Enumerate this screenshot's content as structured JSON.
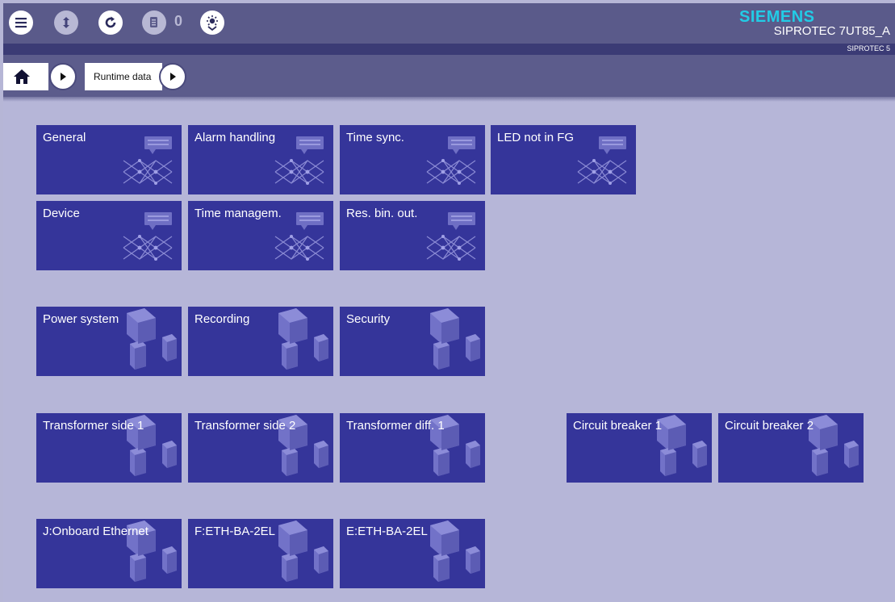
{
  "header": {
    "brand": "SIEMENS",
    "device_name": "SIPROTEC 7UT85_A",
    "device_model": "SIPROTEC 5",
    "notification_count": "0"
  },
  "toolbar": {
    "icons": [
      "menu-icon",
      "upload-download-icon",
      "refresh-icon",
      "log-icon",
      "brightness-icon"
    ]
  },
  "breadcrumb": {
    "items": [
      "Runtime data"
    ]
  },
  "tiles": {
    "general": "General",
    "alarm_handling": "Alarm handling",
    "time_sync": "Time sync.",
    "led_not_in_fg": "LED not in FG",
    "device": "Device",
    "time_managem": "Time managem.",
    "res_bin_out": "Res. bin. out.",
    "power_system": "Power system",
    "recording": "Recording",
    "security": "Security",
    "transformer_side_1": "Transformer side 1",
    "transformer_side_2": "Transformer side 2",
    "transformer_diff_1": "Transformer diff. 1",
    "circuit_breaker_1": "Circuit breaker 1",
    "circuit_breaker_2": "Circuit breaker 2",
    "onboard_ethernet": "J:Onboard Ethernet",
    "f_eth_ba_2el": "F:ETH-BA-2EL",
    "e_eth_ba_2el": "E:ETH-BA-2EL"
  },
  "colors": {
    "accent": "#22cce6",
    "tile": "#35359a",
    "background": "#b6b6d8",
    "topbar": "#5a5a8a"
  }
}
